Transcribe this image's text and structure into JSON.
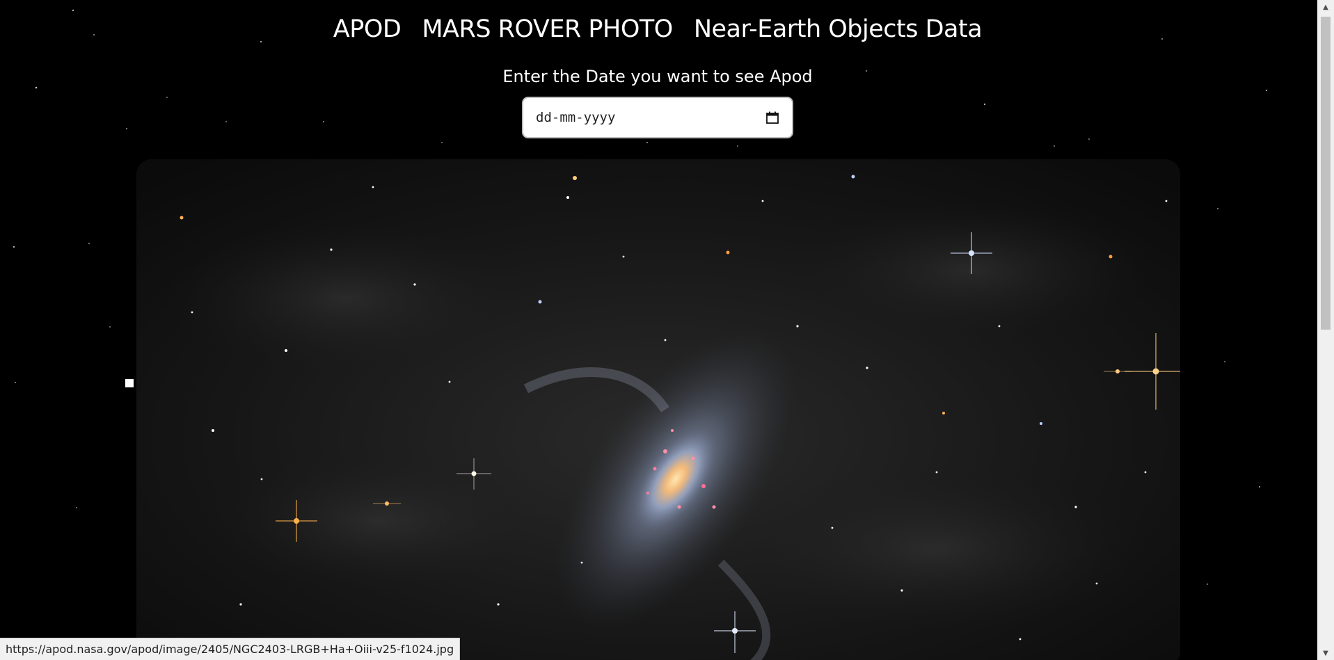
{
  "nav": {
    "items": [
      {
        "label": "APOD"
      },
      {
        "label": "MARS ROVER PHOTO"
      },
      {
        "label": "Near-Earth Objects Data"
      }
    ]
  },
  "date_picker": {
    "label": "Enter the Date you want to see Apod",
    "placeholder": "dd-mm-yyyy",
    "icon": "calendar-icon"
  },
  "apod_image": {
    "subject": "spiral galaxy image"
  },
  "status_bar": {
    "url": "https://apod.nasa.gov/apod/image/2405/NGC2403-LRGB+Ha+Oiii-v25-f1024.jpg"
  },
  "colors": {
    "background": "#000000",
    "text": "#ffffff",
    "input_bg": "#ffffff"
  }
}
